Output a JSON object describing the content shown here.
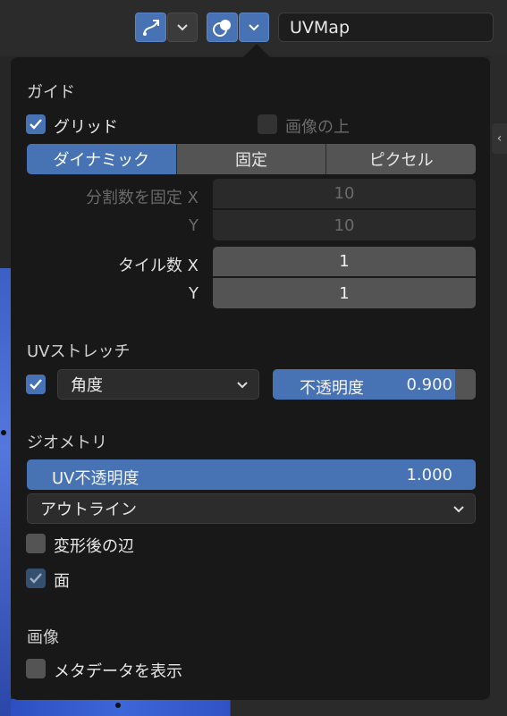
{
  "header": {
    "uv_map_name": "UVMap"
  },
  "guides": {
    "title": "ガイド",
    "grid_label": "グリッド",
    "grid_checked": true,
    "over_image_label": "画像の上",
    "over_image_checked": false,
    "grid_shape_options": [
      "ダイナミック",
      "固定",
      "ピクセル"
    ],
    "grid_shape_selected": "ダイナミック",
    "fixed_subdivisions_x_label": "分割数を固定 X",
    "fixed_subdivisions_x": "10",
    "fixed_subdivisions_y_label": "Y",
    "fixed_subdivisions_y": "10",
    "tiles_x_label": "タイル数 X",
    "tiles_x": "1",
    "tiles_y_label": "Y",
    "tiles_y": "1"
  },
  "uv_stretch": {
    "title": "UVストレッチ",
    "enabled": true,
    "mode": "角度",
    "opacity_label": "不透明度",
    "opacity_value": "0.900",
    "opacity_fraction": 0.9
  },
  "geometry": {
    "title": "ジオメトリ",
    "uv_opacity_label": "UV不透明度",
    "uv_opacity_value": "1.000",
    "uv_opacity_fraction": 1.0,
    "edge_display": "アウトライン",
    "modified_edges_label": "変形後の辺",
    "modified_edges_checked": false,
    "faces_label": "面",
    "faces_checked": true
  },
  "image": {
    "title": "画像",
    "show_metadata_label": "メタデータを表示",
    "show_metadata_checked": false
  },
  "colors": {
    "accent": "#4772b3",
    "panel_bg": "#181818",
    "field_bg": "#545454"
  }
}
